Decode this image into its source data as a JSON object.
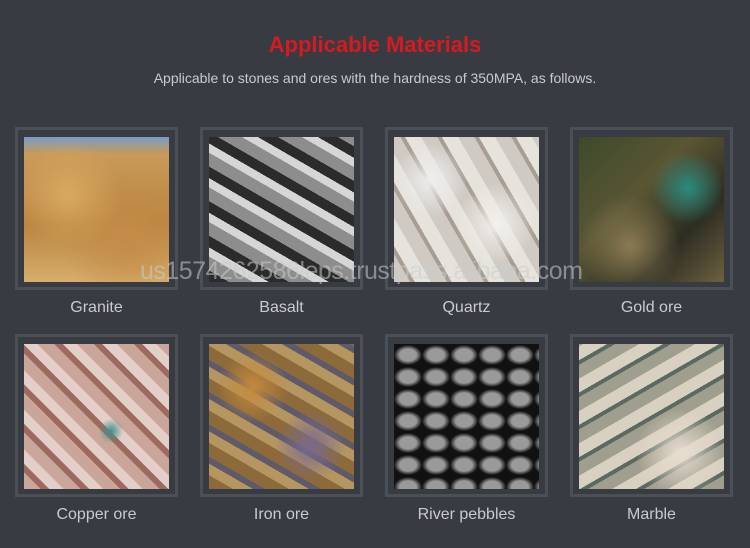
{
  "header": {
    "title": "Applicable Materials",
    "subtitle": "Applicable to stones and ores with the hardness of 350MPA, as follows."
  },
  "materials": [
    {
      "label": "Granite"
    },
    {
      "label": "Basalt"
    },
    {
      "label": "Quartz"
    },
    {
      "label": "Gold ore"
    },
    {
      "label": "Copper ore"
    },
    {
      "label": "Iron ore"
    },
    {
      "label": "River pebbles"
    },
    {
      "label": "Marble"
    }
  ],
  "watermark": "us1574262586leps.trustpass.alibaba.com",
  "colors": {
    "title": "#d71920",
    "background": "#383c42",
    "frame": "#4b5057"
  }
}
